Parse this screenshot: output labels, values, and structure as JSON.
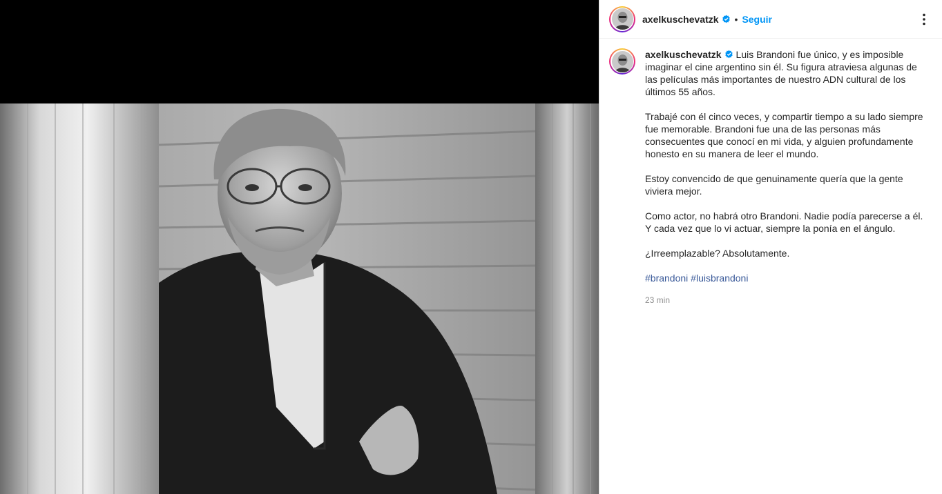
{
  "post": {
    "author": "axelkuschevatzk",
    "follow_label": "Seguir",
    "separator": "•",
    "caption_paragraphs": [
      "Luis Brandoni fue único, y es imposible imaginar el cine argentino sin él. Su figura atraviesa algunas de las películas más importantes de nuestro ADN cultural de los últimos 55 años.",
      "Trabajé con él cinco veces, y compartir tiempo a su lado siempre fue memorable. Brandoni fue una de las personas más consecuentes que conocí en mi vida, y alguien profundamente honesto en su manera de leer el mundo.",
      "Estoy convencido de que genuinamente quería que la gente viviera mejor.",
      "Como actor, no habrá otro Brandoni. Nadie podía parecerse a él. Y cada vez que lo vi actuar, siempre la ponía en el ángulo.",
      "¿Irreemplazable? Absolutamente."
    ],
    "hashtags": [
      "#brandoni",
      "#luisbrandoni"
    ],
    "timestamp": "23 min"
  },
  "icons": {
    "verified": "verified-badge-icon",
    "more": "more-options-icon"
  },
  "colors": {
    "link": "#0095f6",
    "hashtag": "#385898",
    "muted": "#8e8e8e",
    "text": "#262626"
  }
}
